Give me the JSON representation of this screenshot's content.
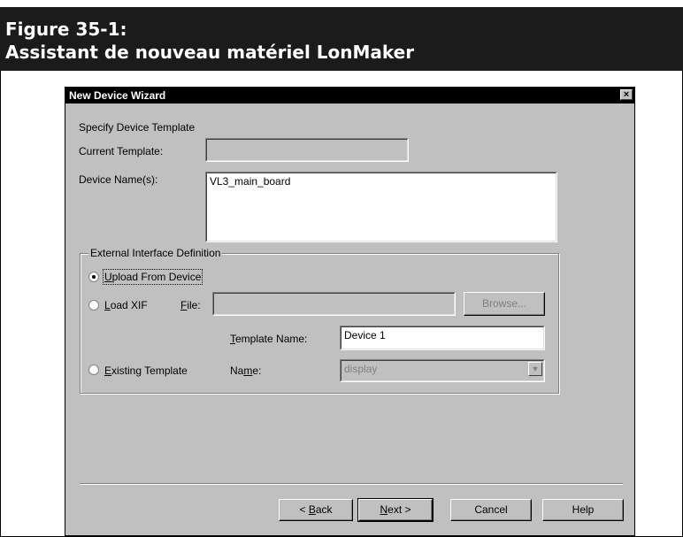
{
  "figure": {
    "line1": "Figure 35-1:",
    "line2": "Assistant de nouveau matériel LonMaker"
  },
  "dialog": {
    "title": "New Device Wizard",
    "close": "×",
    "section_title": "Specify Device Template",
    "current_template": {
      "label": "Current Template:",
      "value": ""
    },
    "device_names": {
      "label": "Device Name(s):",
      "value": "VL3_main_board"
    },
    "group": {
      "caption": "External Interface Definition",
      "upload": {
        "label": "Upload From Device",
        "selected": true
      },
      "load_xif": {
        "label": "Load XIF",
        "selected": false
      },
      "file": {
        "label": "File:",
        "value": ""
      },
      "browse": "Browse...",
      "template_name": {
        "label": "Template Name:",
        "value": "Device 1"
      },
      "existing": {
        "label": "Existing Template",
        "selected": false
      },
      "name": {
        "label": "Name:",
        "value": "display"
      }
    },
    "buttons": {
      "back": "< Back",
      "next": "Next >",
      "cancel": "Cancel",
      "help": "Help"
    }
  }
}
